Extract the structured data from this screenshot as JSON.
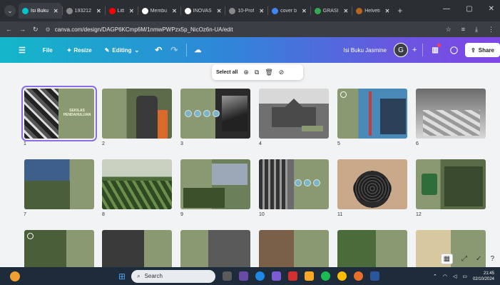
{
  "browser": {
    "tabs": [
      {
        "label": "Isi Buku",
        "color": "#00c4cc",
        "active": true
      },
      {
        "label": "193212",
        "color": "#888888",
        "active": false
      },
      {
        "label": "Litt",
        "color": "#ff0000",
        "active": false
      },
      {
        "label": "Membu",
        "color": "#ffffff",
        "active": false
      },
      {
        "label": "INOVAS",
        "color": "#ffffff",
        "active": false
      },
      {
        "label": "10-Prof",
        "color": "#888888",
        "active": false
      },
      {
        "label": "cover b",
        "color": "#4285f4",
        "active": false
      },
      {
        "label": "GRASI",
        "color": "#34a853",
        "active": false
      },
      {
        "label": "Helveti",
        "color": "#b5651d",
        "active": false
      }
    ],
    "new_tab": "+",
    "url": "canva.com/design/DAGP6KCmp6M/1nmwPWPzx5p_NicOz6n-UA/edit"
  },
  "canva": {
    "menu_icon": "hamburger-icon",
    "file_label": "File",
    "resize_label": "Resize",
    "editing_label": "Editing",
    "design_title": "Isi Buku Jasmine",
    "avatar_letter": "G",
    "share_label": "Share",
    "accent": "#8b6de8"
  },
  "selection_bar": {
    "select_all_label": "Select all"
  },
  "pages": [
    {
      "num": "1",
      "title": "SEKILAS PENDAHULUAN"
    },
    {
      "num": "2"
    },
    {
      "num": "3"
    },
    {
      "num": "4"
    },
    {
      "num": "5"
    },
    {
      "num": "6"
    },
    {
      "num": "7"
    },
    {
      "num": "8"
    },
    {
      "num": "9"
    },
    {
      "num": "10"
    },
    {
      "num": "11"
    },
    {
      "num": "12"
    }
  ],
  "taskbar": {
    "search_placeholder": "Search",
    "time": "21:45",
    "date": "02/10/2024"
  }
}
